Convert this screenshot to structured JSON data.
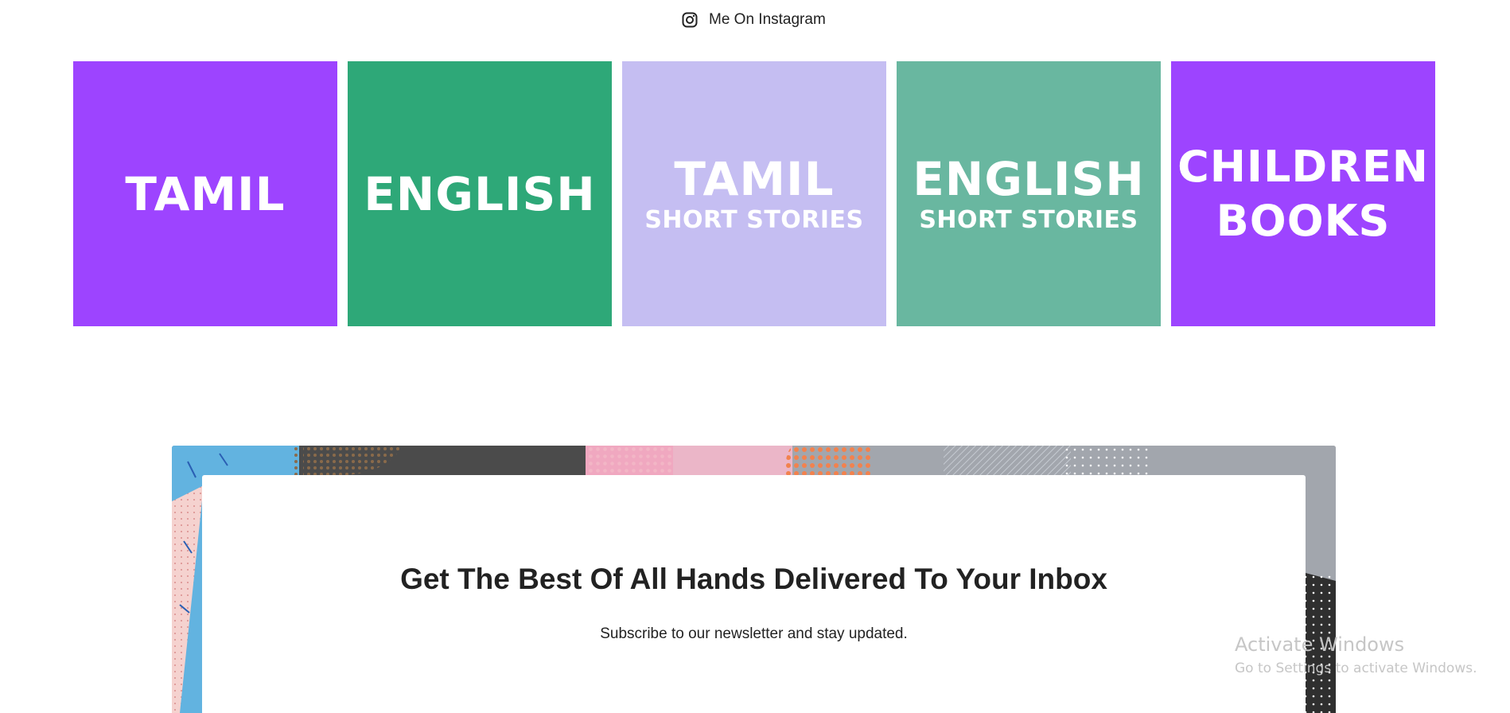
{
  "instagram": {
    "label": "Me On Instagram",
    "icon": "instagram-icon"
  },
  "tiles": [
    {
      "title": "TAMIL",
      "subtitle": "",
      "color": "#9d44ff"
    },
    {
      "title": "ENGLISH",
      "subtitle": "",
      "color": "#2ea878"
    },
    {
      "title": "TAMIL",
      "subtitle": "SHORT STORIES",
      "color": "#c5bef2"
    },
    {
      "title": "ENGLISH",
      "subtitle": "SHORT STORIES",
      "color": "#69b7a0"
    },
    {
      "title_line1": "CHILDREN",
      "title_line2": "BOOKS",
      "color": "#9d44ff"
    }
  ],
  "newsletter": {
    "heading": "Get The Best Of All Hands Delivered To Your Inbox",
    "subtext": "Subscribe to our newsletter and stay updated."
  },
  "watermark": {
    "line1": "Activate Windows",
    "line2": "Go to Settings to activate Windows."
  }
}
